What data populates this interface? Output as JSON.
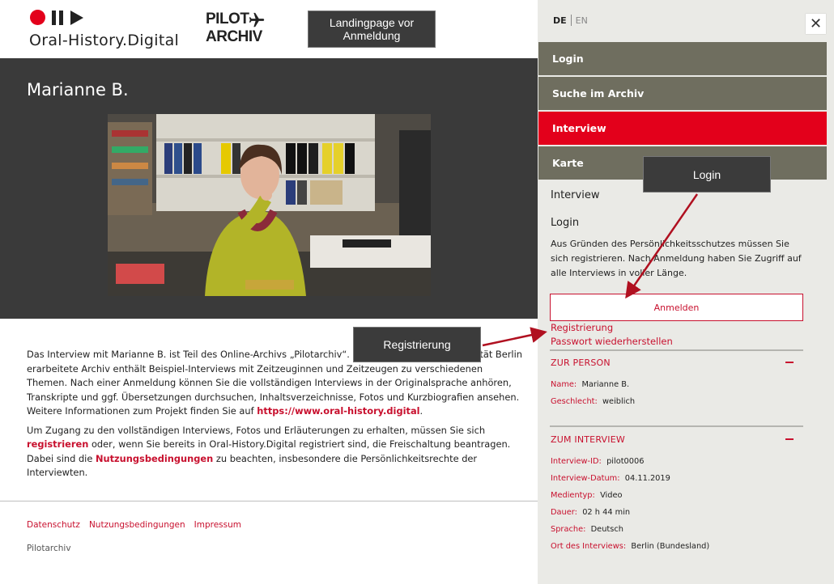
{
  "header": {
    "logo_text": "Oral-History.Digital",
    "pilot_logo_line1": "PILOT",
    "pilot_logo_line2": "ARCHIV",
    "icons": [
      "record-icon",
      "pause-icon",
      "play-icon",
      "airplane-icon"
    ],
    "annotation": "Landingpage vor Anmeldung"
  },
  "hero": {
    "name": "Marianne B."
  },
  "intro": {
    "p1": "Das Interview mit Marianne B. ist Teil des Online-Archivs „Pilotarchiv“. Das von der Freien Universität Berlin erarbeitete Archiv enthält Beispiel-Interviews mit Zeitzeuginnen und Zeitzeugen zu verschiedenen Themen. Nach einer Anmeldung können Sie die vollständigen Interviews in der Originalsprache anhören, Transkripte und ggf. Übersetzungen durchsuchen, Inhaltsverzeichnisse, Fotos und Kurzbiografien ansehen.  Weitere Informationen zum Projekt finden Sie auf ",
    "p1_link": "https://www.oral-history.digital",
    "p1_end": ".",
    "p2_a": "Um Zugang zu den vollständigen Interviews, Fotos und Erläuterungen zu erhalten, müssen Sie sich ",
    "p2_link1": "registrieren",
    "p2_b": " oder, wenn Sie bereits in Oral-History.Digital registriert sind, die Freischaltung beantragen. Dabei sind die ",
    "p2_link2": "Nutzungsbedingungen",
    "p2_c": " zu beachten, insbesondere die Persönlichkeitsrechte der Interviewten."
  },
  "footer": {
    "links": [
      "Datenschutz",
      "Nutzungsbedingungen",
      "Impressum"
    ],
    "copy": "Pilotarchiv"
  },
  "sidebar": {
    "lang_de": "DE",
    "lang_en": "EN",
    "close": "✕",
    "nav": [
      {
        "label": "Login",
        "active": false
      },
      {
        "label": "Suche im Archiv",
        "active": false
      },
      {
        "label": "Interview",
        "active": true
      },
      {
        "label": "Karte",
        "active": false
      }
    ],
    "interview_heading": "Interview",
    "login_heading": "Login",
    "login_text": "Aus Gründen des Persönlichkeitsschutzes müssen Sie sich registrieren. Nach Anmeldung haben Sie Zugriff auf alle Interviews in voller Länge.",
    "login_button": "Anmelden",
    "register_link": "Registrierung",
    "password_link": "Passwort wiederherstellen",
    "person_section": {
      "title": "ZUR PERSON",
      "fields": [
        {
          "label": "Name:",
          "value": "Marianne B."
        },
        {
          "label": "Geschlecht:",
          "value": "weiblich"
        }
      ]
    },
    "interview_section": {
      "title": "ZUM INTERVIEW",
      "fields": [
        {
          "label": "Interview-ID:",
          "value": "pilot0006"
        },
        {
          "label": "Interview-Datum:",
          "value": "04.11.2019"
        },
        {
          "label": "Medientyp:",
          "value": "Video"
        },
        {
          "label": "Dauer:",
          "value": "02 h 44 min"
        },
        {
          "label": "Sprache:",
          "value": "Deutsch"
        },
        {
          "label": "Ort des Interviews:",
          "value": "Berlin (Bundesland)"
        }
      ]
    }
  },
  "annotations": {
    "login": "Login",
    "registrierung": "Registrierung"
  },
  "colors": {
    "accent": "#e3001b",
    "nav_bg": "#6f6e5f",
    "sidebar_bg": "#eaeae6",
    "hero_bg": "#3a3a3a"
  }
}
